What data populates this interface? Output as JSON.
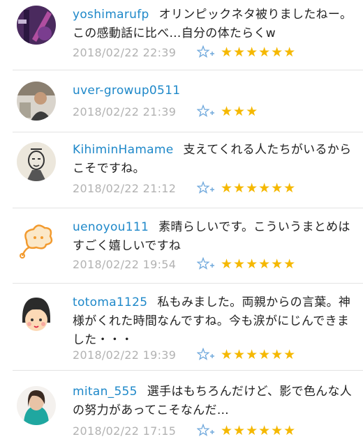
{
  "comments": [
    {
      "username": "yoshimarufp",
      "text": "オリンピックネタ被りましたねー。この感動話に比べ…自分の体たらくw",
      "date": "2018/02/22 22:39",
      "stars": "★★★★★★",
      "star_count": 6
    },
    {
      "username": "uver-growup0511",
      "text": "",
      "date": "2018/02/22 21:39",
      "stars": "★★★",
      "star_count": 3
    },
    {
      "username": "KihiminHamame",
      "text": "支えてくれる人たちがいるからこそですね。",
      "date": "2018/02/22 21:12",
      "stars": "★★★★★★",
      "star_count": 6
    },
    {
      "username": "uenoyou111",
      "text": "素晴らしいです。こういうまとめはすごく嬉しいですね",
      "date": "2018/02/22 19:54",
      "stars": "★★★★★★",
      "star_count": 6
    },
    {
      "username": "totoma1125",
      "text": "私もみました。両親からの言葉。神様がくれた時間なんですね。今も涙がにじんできました・・・",
      "date": "2018/02/22 19:39",
      "stars": "★★★★★★",
      "star_count": 6
    },
    {
      "username": "mitan_555",
      "text": "選手はもちろんだけど、影で色んな人の努力があってこそなんだ…",
      "date": "2018/02/22 17:15",
      "stars": "★★★★★★",
      "star_count": 6
    }
  ],
  "colors": {
    "username": "#1e88c9",
    "date": "#b2b2b2",
    "star": "#f5b800",
    "add_star_icon": "#6fa8dc"
  },
  "icons": {
    "add_star": "star-plus-icon"
  }
}
